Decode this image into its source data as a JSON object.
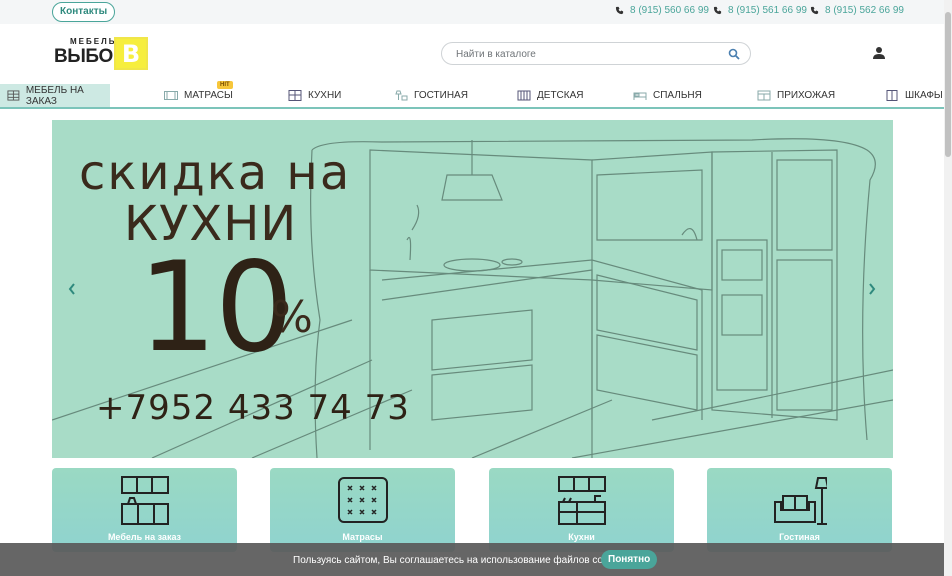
{
  "topbar": {
    "contacts_label": "Контакты",
    "phones": [
      "8 (915) 560 66 99",
      "8 (915) 561 66 99",
      "8 (915) 562 66 99"
    ]
  },
  "header": {
    "logo_small": "МЕБЕЛЬ",
    "logo_big": "ВЫБОР",
    "logo_letter": "В",
    "search_placeholder": "Найти в каталоге"
  },
  "nav": {
    "items": [
      {
        "label": "МЕБЕЛЬ НА ЗАКАЗ",
        "icon": "grid-icon"
      },
      {
        "label": "МАТРАСЫ",
        "icon": "mattress-icon"
      },
      {
        "label": "КУХНИ",
        "icon": "kitchen-icon"
      },
      {
        "label": "ГОСТИНАЯ",
        "icon": "lamp-icon"
      },
      {
        "label": "ДЕТСКАЯ",
        "icon": "crib-icon"
      },
      {
        "label": "СПАЛЬНЯ",
        "icon": "bed-icon"
      },
      {
        "label": "ПРИХОЖАЯ",
        "icon": "hallway-icon"
      },
      {
        "label": "ШКАФЫ",
        "icon": "wardrobe-icon"
      }
    ],
    "hit_badge": "HIT"
  },
  "banner": {
    "line1": "скидка на",
    "line2": "КУХНИ",
    "line3": "10",
    "percent": "%",
    "phone": "+7952 433 74 73"
  },
  "tiles": [
    {
      "label": "Мебель на заказ",
      "icon": "furniture-icon"
    },
    {
      "label": "Матрасы",
      "icon": "mattress-icon"
    },
    {
      "label": "Кухни",
      "icon": "kitchen-icon"
    },
    {
      "label": "Гостиная",
      "icon": "sofa-lamp-icon"
    }
  ],
  "cookie": {
    "text": "Пользуясь сайтом, Вы соглашаетесь на использование файлов cookie.",
    "button": "Понятно"
  },
  "colors": {
    "accent": "#4aa59a",
    "banner_bg": "#a8dcc7",
    "active_nav_bg": "#cde9e3",
    "logo_yellow": "#f6ee3e"
  }
}
